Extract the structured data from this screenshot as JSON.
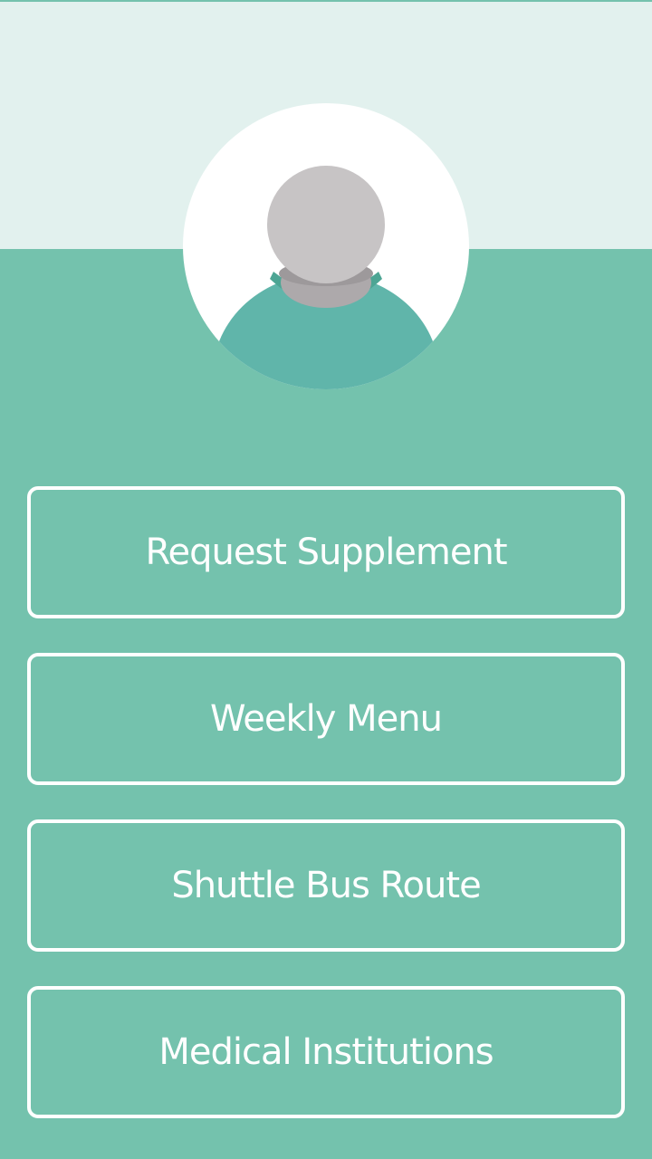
{
  "theme": {
    "primary": "#74c2ad",
    "header_background": "#e2f1ee",
    "button_border": "#ffffff",
    "button_text": "#ffffff"
  },
  "profile": {
    "avatar_icon": "person-icon"
  },
  "menu": {
    "items": [
      {
        "label": "Request Supplement"
      },
      {
        "label": "Weekly Menu"
      },
      {
        "label": "Shuttle Bus Route"
      },
      {
        "label": "Medical Institutions"
      }
    ]
  }
}
